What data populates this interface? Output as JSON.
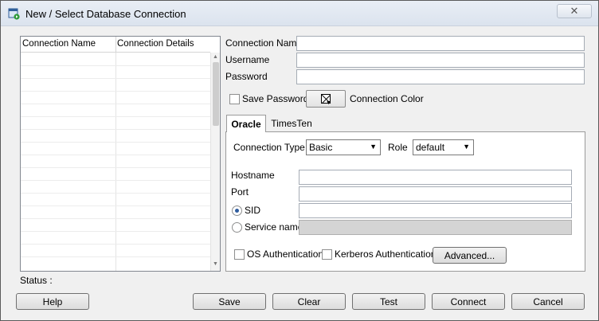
{
  "window": {
    "title": "New / Select Database Connection"
  },
  "table": {
    "columns": [
      "Connection Name",
      "Connection Details"
    ],
    "rows": []
  },
  "status": {
    "label": "Status :"
  },
  "fields": {
    "connection_name_label": "Connection Name",
    "connection_name_value": "",
    "username_label": "Username",
    "username_value": "",
    "password_label": "Password",
    "password_value": "",
    "save_password_label": "Save Password",
    "connection_color_label": "Connection Color"
  },
  "tabs": [
    {
      "label": "Oracle",
      "active": true
    },
    {
      "label": "TimesTen",
      "active": false
    }
  ],
  "oracle": {
    "connection_type_label": "Connection Type",
    "connection_type_value": "Basic",
    "role_label": "Role",
    "role_value": "default",
    "hostname_label": "Hostname",
    "port_label": "Port",
    "sid_label": "SID",
    "service_name_label": "Service name",
    "os_auth_label": "OS Authentication",
    "kerberos_auth_label": "Kerberos Authentication",
    "advanced_label": "Advanced...",
    "selected_radio": "SID"
  },
  "buttons": {
    "help": "Help",
    "save": "Save",
    "clear": "Clear",
    "test": "Test",
    "connect": "Connect",
    "cancel": "Cancel"
  },
  "icons": {
    "app": "database-connection-icon",
    "close": "close-icon",
    "color_swatch": "color-swatch-icon"
  }
}
